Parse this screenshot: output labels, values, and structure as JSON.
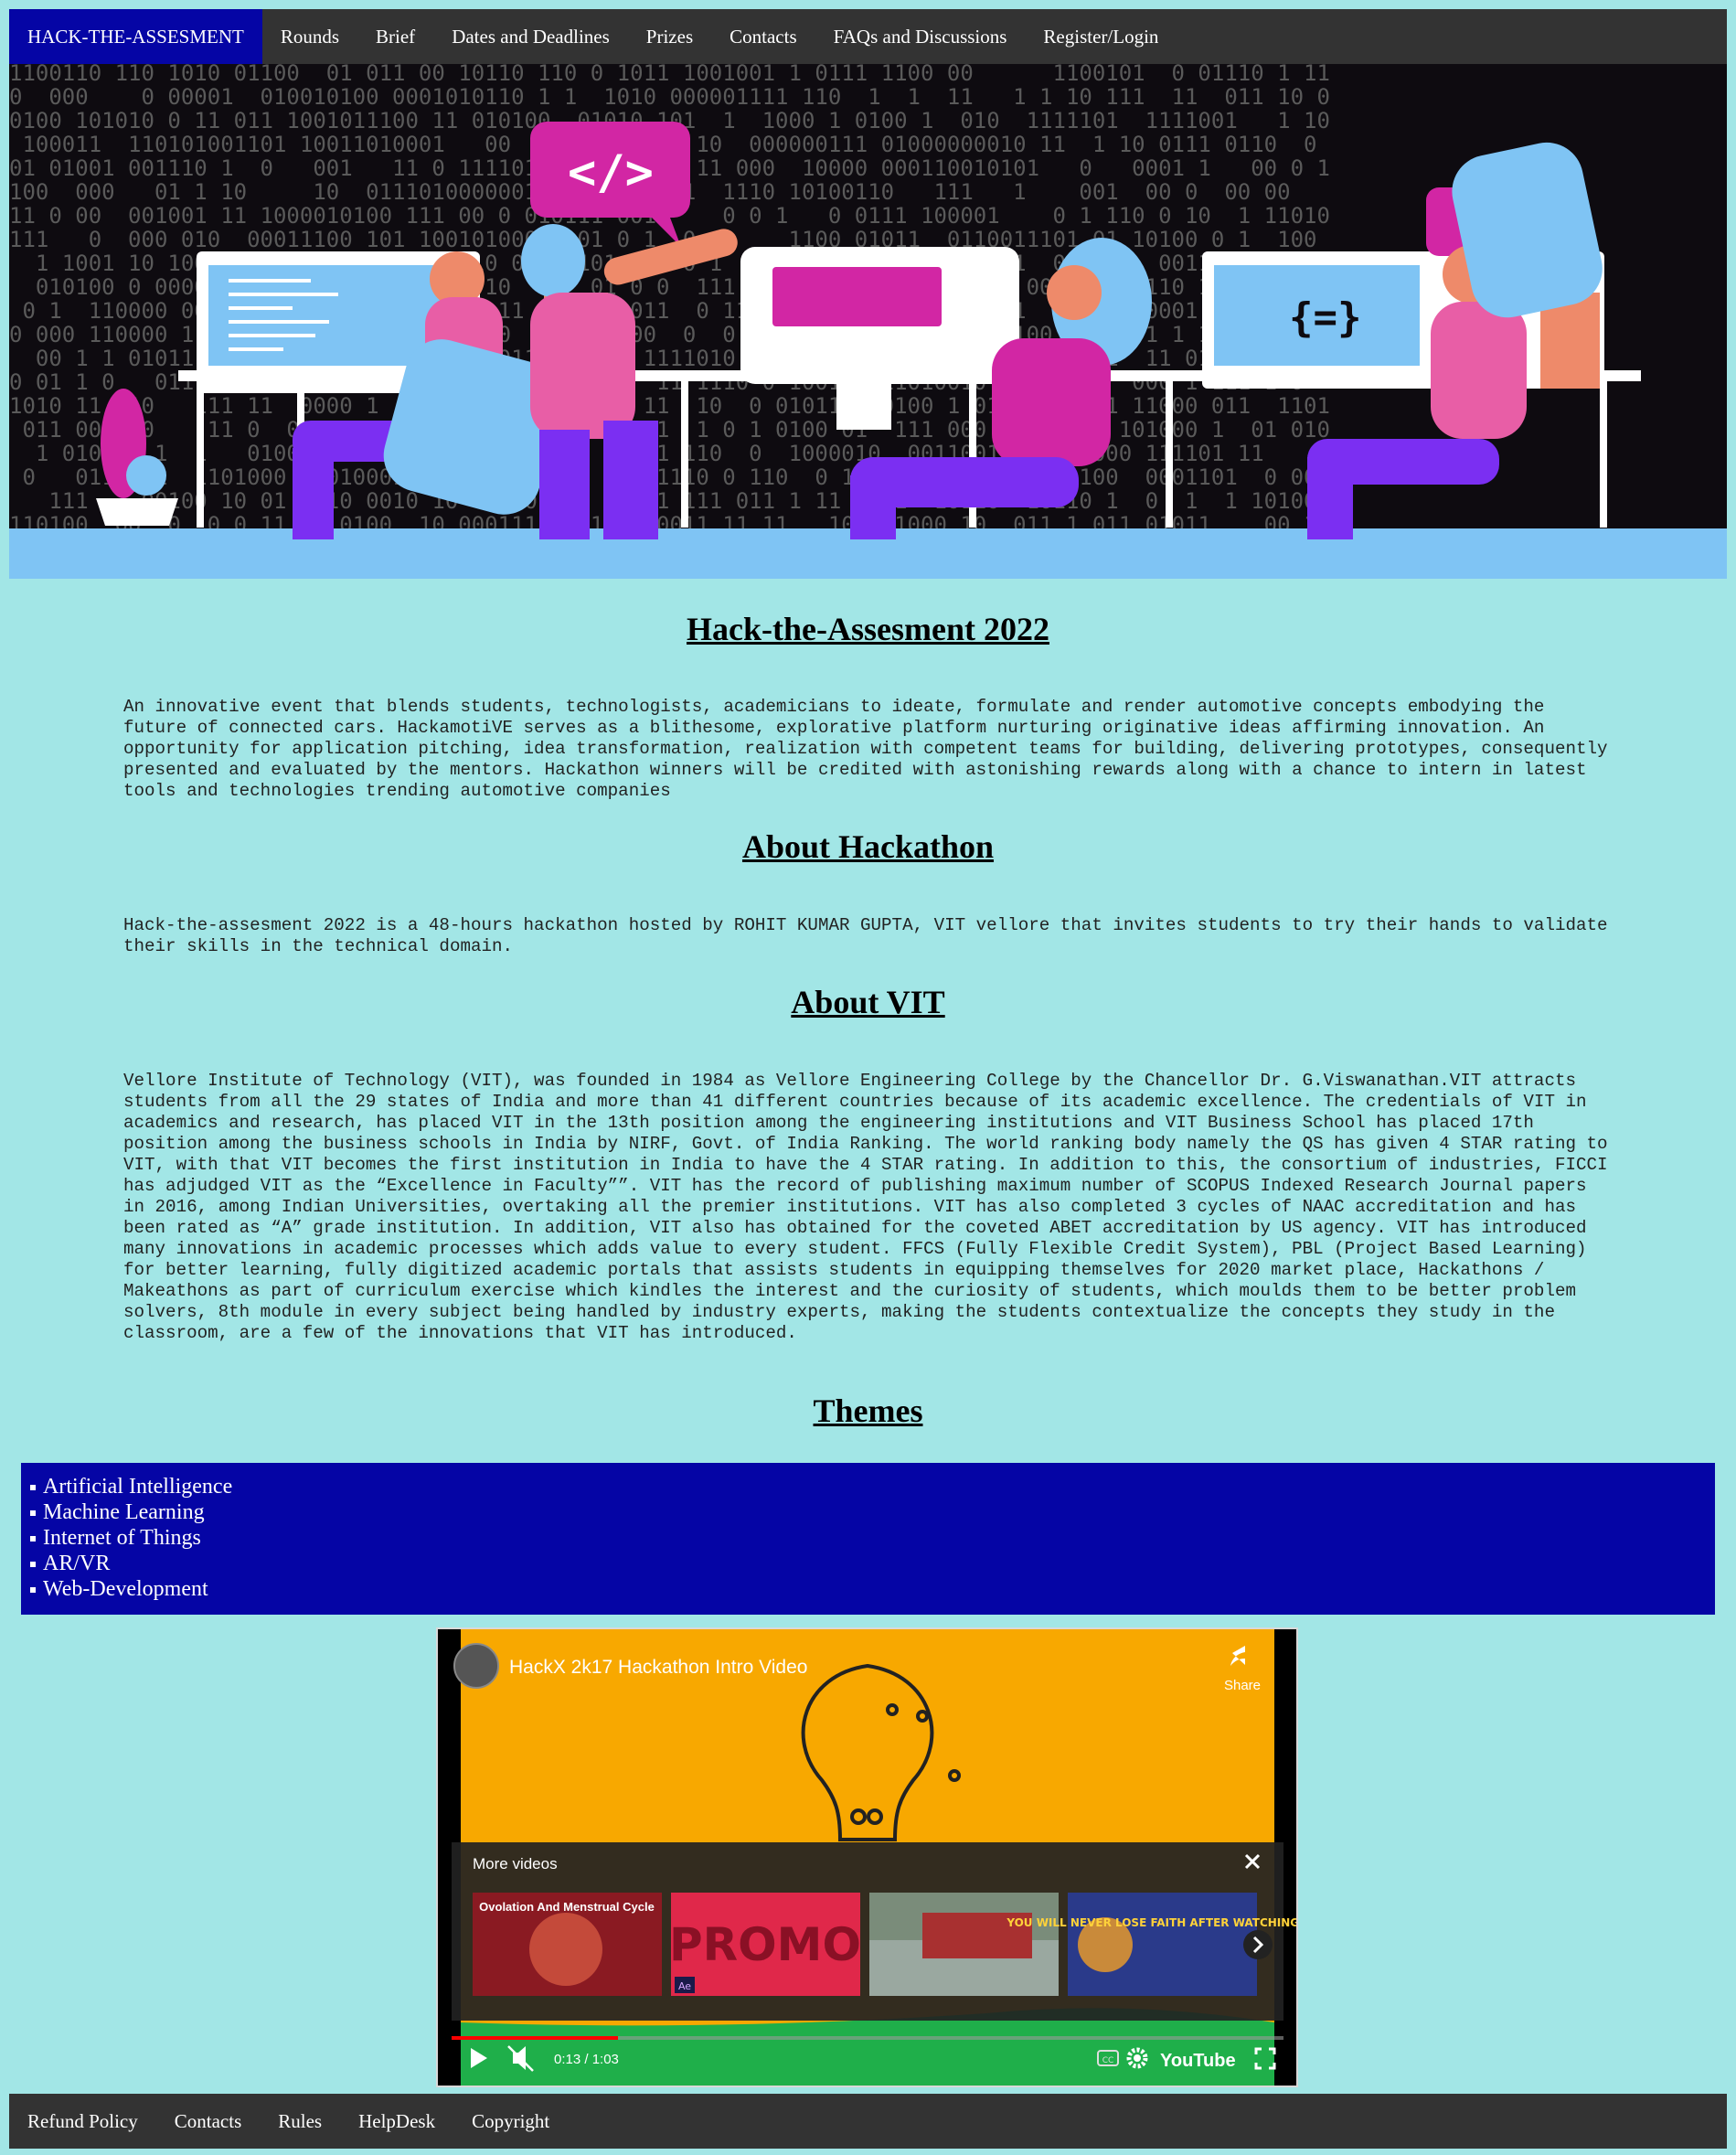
{
  "nav": {
    "brand": "HACK-THE-ASSESMENT",
    "items": [
      "Rounds",
      "Brief",
      "Dates and Deadlines",
      "Prizes",
      "Contacts",
      "FAQs and Discussions",
      "Register/Login"
    ]
  },
  "hero": {
    "bubble_code_1": "</>",
    "bubble_code_2": "</>",
    "screen_code": "{=}",
    "colors": {
      "background": "#0e0b10",
      "floor": "#7fc4f4",
      "accent": "#d226a4",
      "purple": "#7b2ff2"
    }
  },
  "main": {
    "title": "Hack-the-Assesment 2022",
    "intro": "An innovative event that blends students, technologists, academicians to ideate, formulate and render automotive concepts embodying the future of connected cars. HackamotiVE serves as a blithesome, explorative platform nurturing originative ideas affirming innovation. An opportunity for application pitching, idea transformation, realization with competent teams for building, delivering prototypes, consequently presented and evaluated by the mentors. Hackathon winners will be credited with astonishing rewards along with a chance to intern in latest tools and technologies trending automotive companies",
    "about_hackathon_heading": "About Hackathon",
    "about_hackathon": "Hack-the-assesment 2022 is a 48-hours hackathon hosted by ROHIT KUMAR GUPTA, VIT vellore that invites students to try their hands to validate their skills in the technical domain.",
    "about_vit_heading": "About VIT",
    "about_vit": "Vellore Institute of Technology (VIT), was founded in 1984 as Vellore Engineering College by the Chancellor Dr. G.Viswanathan.VIT attracts students from all the 29 states of India and more than 41 different countries because of its academic excellence. The credentials of VIT in academics and research, has placed VIT in the 13th position among the engineering institutions and VIT Business School has placed 17th position among the business schools in India by NIRF, Govt. of India Ranking. The world ranking body namely the QS has given 4 STAR rating to VIT, with that VIT becomes the first institution in India to have the 4 STAR rating. In addition to this, the consortium of industries, FICCI has adjudged VIT as the “Excellence in Faculty””. VIT has the record of publishing maximum number of SCOPUS Indexed Research Journal papers in 2016, among Indian Universities, overtaking all the premier institutions. VIT has also completed 3 cycles of NAAC accreditation and has been rated as “A” grade institution. In addition, VIT also has obtained for the coveted ABET accreditation by US agency. VIT has introduced many innovations in academic processes which adds value to every student. FFCS (Fully Flexible Credit System), PBL (Project Based Learning) for better learning, fully digitized academic portals that assists students in equipping themselves for 2020 market place, Hackathons / Makeathons as part of curriculum exercise which kindles the interest and the curiosity of students, which moulds them to be better problem solvers, 8th module in every subject being handled by industry experts, making the students contextualize the concepts they study in the classroom, are a few of the innovations that VIT has introduced.",
    "themes_heading": "Themes",
    "themes": [
      "Artificial Intelligence",
      "Machine Learning",
      "Internet of Things",
      "AR/VR",
      "Web-Development"
    ]
  },
  "video": {
    "title": "HackX 2k17 Hackathon Intro Video",
    "share_label": "Share",
    "more_videos_label": "More videos",
    "thumb1_text": "Ovolation And Menstrual Cycle",
    "thumb2_text": "PROMO",
    "thumb2_badge": "Ae",
    "thumb4_text": "YOU WILL NEVER LOSE FAITH AFTER WATCHING THIS",
    "time": "0:13 / 1:03",
    "youtube_label": "YouTube",
    "progress_fraction": 0.2
  },
  "footer": {
    "items": [
      "Refund Policy",
      "Contacts",
      "Rules",
      "HelpDesk",
      "Copyright"
    ]
  }
}
